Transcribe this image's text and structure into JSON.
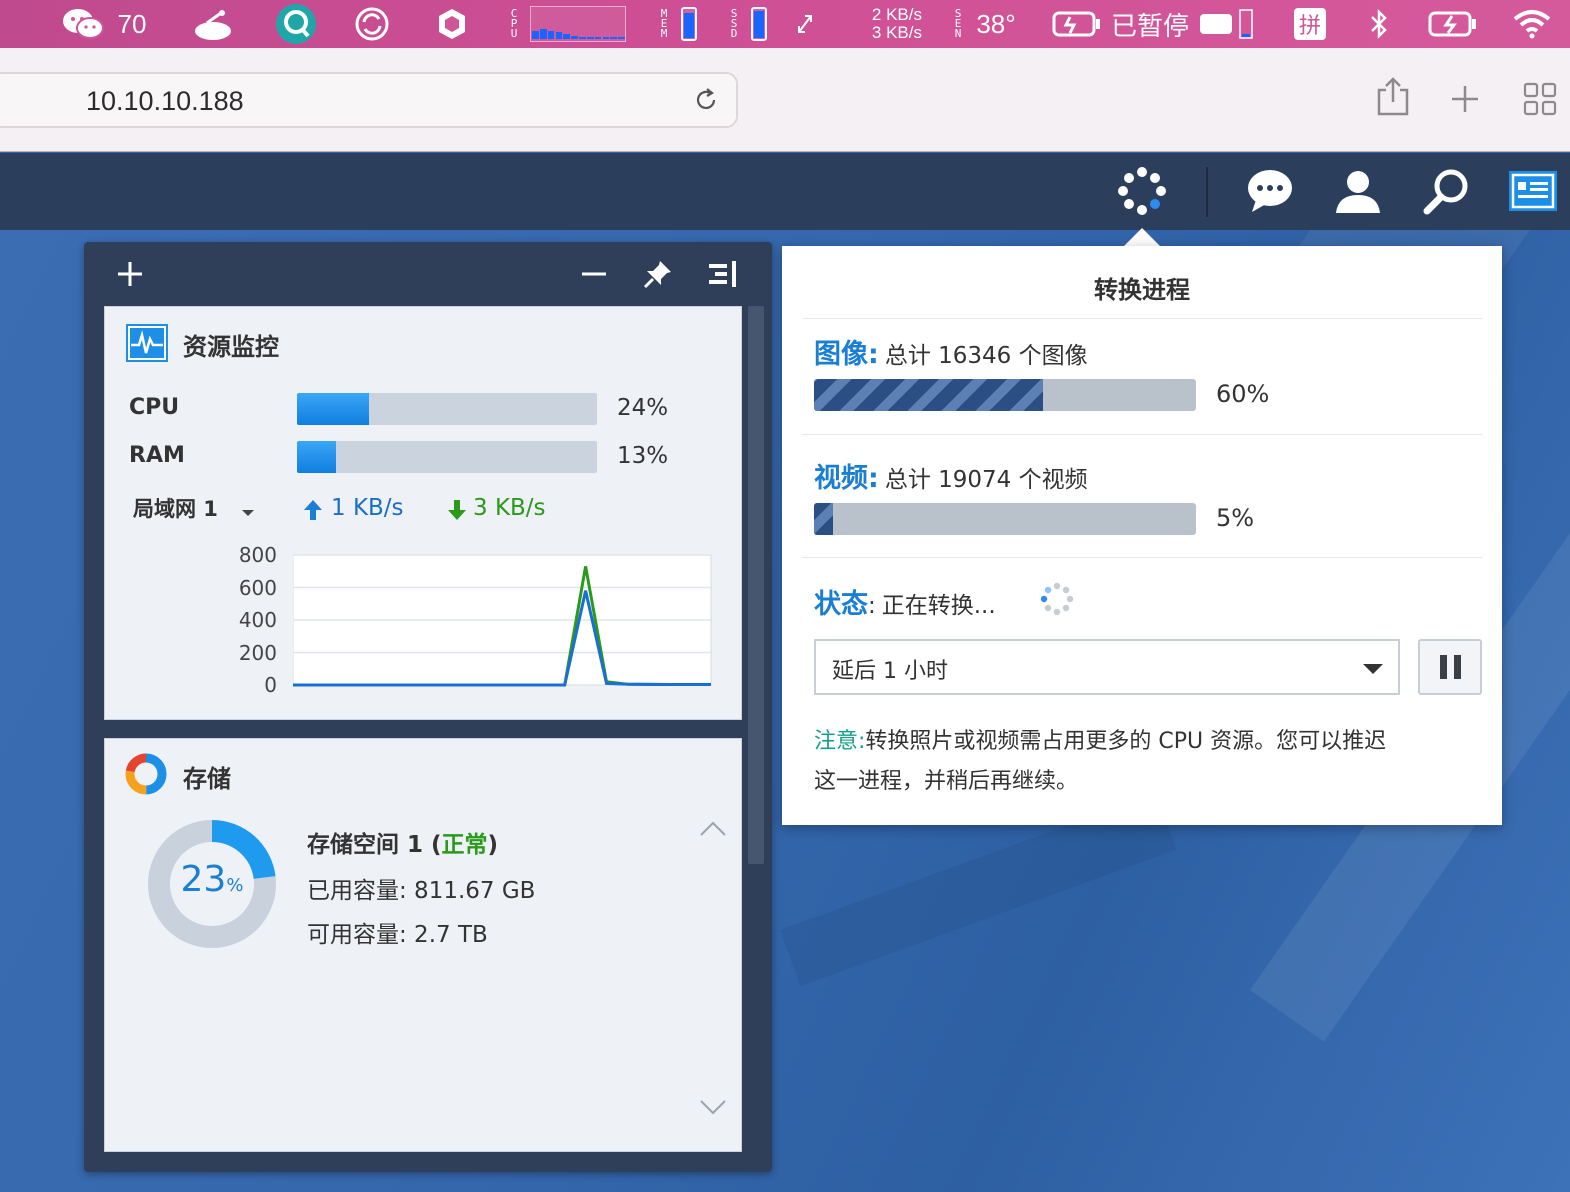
{
  "menubar": {
    "wechat_count": "70",
    "cpu_label": "CPU",
    "mem_label": "MEM",
    "ssd_label": "SSD",
    "net_up": "2 KB/s",
    "net_down": "3 KB/s",
    "sensor_label": "SEN",
    "temperature": "38°",
    "vpn_status": "已暂停",
    "input_method": "拼",
    "mem_level": 0.85,
    "ssd_level": 0.9,
    "cpu_history": [
      0.25,
      0.3,
      0.25,
      0.2,
      0.15,
      0.1,
      0.05,
      0.05,
      0.05,
      0.05,
      0.05,
      0.05
    ]
  },
  "browser": {
    "url": "10.10.10.188"
  },
  "icons": {
    "menubar": [
      "wechat-icon",
      "cloud-disk-icon",
      "search-app-icon",
      "sync-icon",
      "hexagon-icon",
      "fullscreen-icon",
      "battery-icon",
      "bluetooth-icon",
      "wifi-icon"
    ],
    "browser": [
      "reload-icon",
      "share-icon",
      "new-tab-icon",
      "tab-overview-icon"
    ],
    "dsm_top": [
      "background-tasks-icon",
      "chat-icon",
      "user-icon",
      "search-icon",
      "widgets-icon"
    ],
    "panel": [
      "add-widget-icon",
      "minimize-icon",
      "pin-icon",
      "panel-toggle-icon"
    ]
  },
  "colors": {
    "accent_blue": "#1a7fd4",
    "green": "#2a9a1a",
    "teal": "#14a08c",
    "dsm_bar": "#2b3f5d",
    "desktop": "#3464a8"
  },
  "resource_monitor": {
    "title": "资源监控",
    "cpu_label": "CPU",
    "cpu_pct": "24%",
    "cpu_value": 24,
    "ram_label": "RAM",
    "ram_pct": "13%",
    "ram_value": 13,
    "lan_label": "局域网 1",
    "upload": "1 KB/s",
    "download": "3 KB/s"
  },
  "chart_data": {
    "type": "line",
    "title": "",
    "xlabel": "",
    "ylabel": "",
    "ylim": [
      0,
      800
    ],
    "yticks": [
      "800",
      "600",
      "400",
      "200",
      "0"
    ],
    "grid": true,
    "x": [
      0,
      1,
      2,
      3,
      4,
      5,
      6,
      7,
      8,
      9,
      10,
      11,
      12,
      13,
      14,
      15,
      16,
      17,
      18,
      19,
      20
    ],
    "series": [
      {
        "color": "#2a9a1a",
        "values": [
          0,
          0,
          0,
          0,
          0,
          0,
          0,
          0,
          0,
          0,
          0,
          0,
          0,
          0,
          730,
          20,
          5,
          5,
          3,
          3,
          3
        ]
      },
      {
        "color": "#1a6fd4",
        "values": [
          0,
          0,
          0,
          0,
          0,
          0,
          0,
          0,
          0,
          0,
          0,
          0,
          0,
          0,
          580,
          10,
          5,
          3,
          3,
          3,
          3
        ]
      }
    ]
  },
  "storage": {
    "title": "存储",
    "usage_pct": "23",
    "usage_unit": "%",
    "usage_value": 23,
    "volume_name": "存储空间 1",
    "status_open": "(",
    "status": "正常",
    "status_close": ")",
    "used": "已用容量: 811.67 GB",
    "free": "可用容量: 2.7 TB"
  },
  "conversion": {
    "title": "转换进程",
    "image_label": "图像:",
    "image_total": "总计 16346 个图像",
    "image_pct": "60%",
    "image_value": 60,
    "video_label": "视频:",
    "video_total": "总计 19074 个视频",
    "video_pct": "5%",
    "video_value": 5,
    "status_label": "状态",
    "status_colon": ":",
    "status_text": "正在转换...",
    "delay_option": "延后 1 小时",
    "note_label": "注意:",
    "note_text_line1": "转换照片或视频需占用更多的 CPU 资源。您可以推迟",
    "note_text_line2": "这一进程，并稍后再继续。"
  }
}
